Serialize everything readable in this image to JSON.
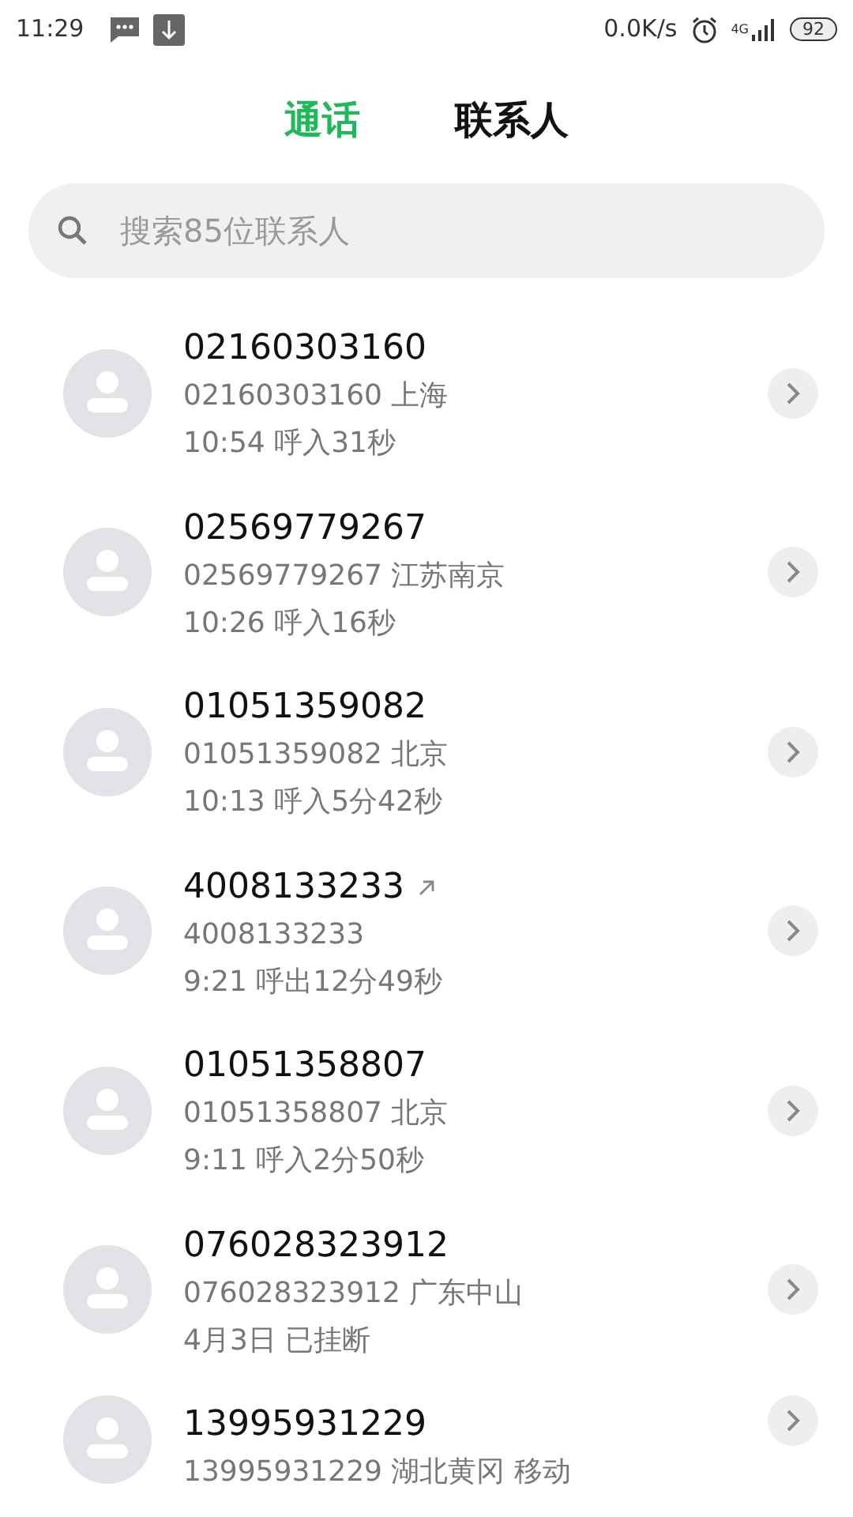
{
  "status_bar": {
    "time": "11:29",
    "speed": "0.0K/s",
    "network": "4G",
    "battery": "92"
  },
  "tabs": [
    {
      "label": "通话",
      "selected": true
    },
    {
      "label": "联系人",
      "selected": false
    }
  ],
  "search": {
    "placeholder": "搜索85位联系人"
  },
  "calls": [
    {
      "number": "02160303160",
      "detail": "02160303160 上海",
      "meta": "10:54 呼入31秒",
      "outgoing": false
    },
    {
      "number": "02569779267",
      "detail": "02569779267 江苏南京",
      "meta": "10:26 呼入16秒",
      "outgoing": false
    },
    {
      "number": "01051359082",
      "detail": "01051359082 北京",
      "meta": "10:13 呼入5分42秒",
      "outgoing": false
    },
    {
      "number": "4008133233",
      "detail": "4008133233",
      "meta": "9:21 呼出12分49秒",
      "outgoing": true
    },
    {
      "number": "01051358807",
      "detail": "01051358807 北京",
      "meta": "9:11 呼入2分50秒",
      "outgoing": false
    },
    {
      "number": "076028323912",
      "detail": "076028323912 广东中山",
      "meta": "4月3日 已挂断",
      "outgoing": false
    },
    {
      "number": "13995931229",
      "detail": "13995931229 湖北黄冈 移动",
      "outgoing": false
    }
  ]
}
